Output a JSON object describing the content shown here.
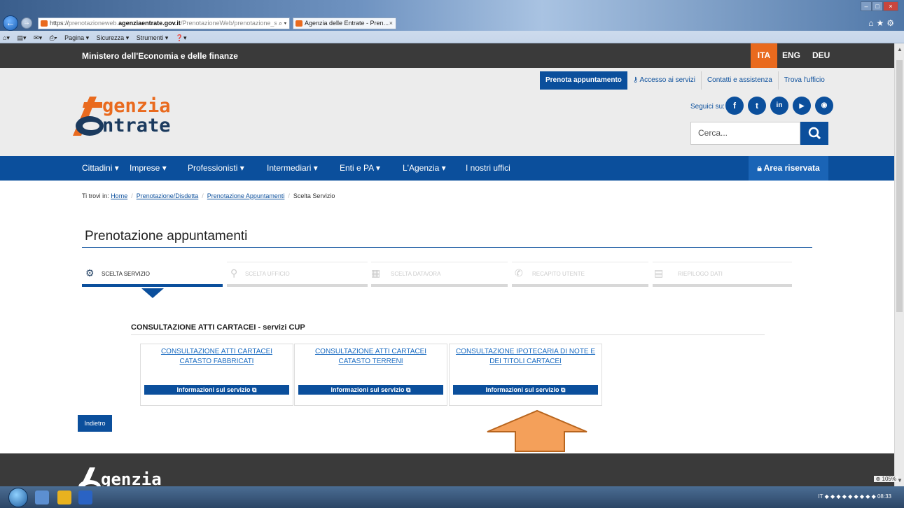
{
  "browser": {
    "url_prefix": "https://",
    "url_gray1": "prenotazioneweb.",
    "url_domain": "agenziaentrate.gov.it",
    "url_gray2": "/PrenotazioneWeb/prenotazione_sceltr",
    "tab_title": "Agenzia delle Entrate - Pren...",
    "commands": [
      "Pagina ▾",
      "Sicurezza ▾",
      "Strumenti ▾"
    ],
    "zoom": "105%",
    "clock": "08:33",
    "lang_indicator": "IT"
  },
  "topbar": {
    "ministry": "Ministero dell'Economia e delle finanze",
    "languages": [
      "ITA",
      "ENG",
      "DEU"
    ]
  },
  "header": {
    "util_nav": [
      "Prenota appuntamento",
      "Accesso ai servizi",
      "Contatti e assistenza",
      "Trova l'ufficio"
    ],
    "seguici": "Seguici su:",
    "social": [
      "f",
      "t",
      "in",
      "▶",
      "rss"
    ],
    "search_placeholder": "Cerca...",
    "logo_line1": "genzia",
    "logo_line2": "ntrate"
  },
  "mainnav": {
    "items": [
      "Cittadini",
      "Imprese",
      "Professionisti",
      "Intermediari",
      "Enti e PA",
      "L'Agenzia",
      "I nostri uffici"
    ],
    "area_riservata": "Area riservata"
  },
  "breadcrumb": {
    "prefix": "Ti trovi in:",
    "links": [
      "Home",
      "Prenotazione/Disdetta",
      "Prenotazione Appuntamenti"
    ],
    "current": "Scelta Servizio"
  },
  "page_title": "Prenotazione appuntamenti",
  "steps": [
    {
      "label": "SCELTA SERVIZIO",
      "active": true
    },
    {
      "label": "SCELTA UFFICIO",
      "active": false
    },
    {
      "label": "SCELTA DATA/ORA",
      "active": false
    },
    {
      "label": "RECAPITO UTENTE",
      "active": false
    },
    {
      "label": "RIEPILOGO DATI",
      "active": false
    }
  ],
  "section_title": "CONSULTAZIONE ATTI CARTACEI - servizi CUP",
  "cards": [
    {
      "line1": "CONSULTAZIONE ATTI CARTACEI",
      "line2": "CATASTO FABBRICATI",
      "info": "Informazioni sul servizio"
    },
    {
      "line1": "CONSULTAZIONE ATTI CARTACEI",
      "line2": "CATASTO TERRENI",
      "info": "Informazioni sul servizio"
    },
    {
      "line1": "CONSULTAZIONE IPOTECARIA DI NOTE E",
      "line2": "DEI TITOLI CARTACEI",
      "info": "Informazioni sul servizio"
    }
  ],
  "back_button": "Indietro",
  "footer": {
    "logo_text": "genzia"
  },
  "colors": {
    "primary": "#0b4f9c",
    "accent": "#e96a1e",
    "dark": "#3a3a3a"
  }
}
